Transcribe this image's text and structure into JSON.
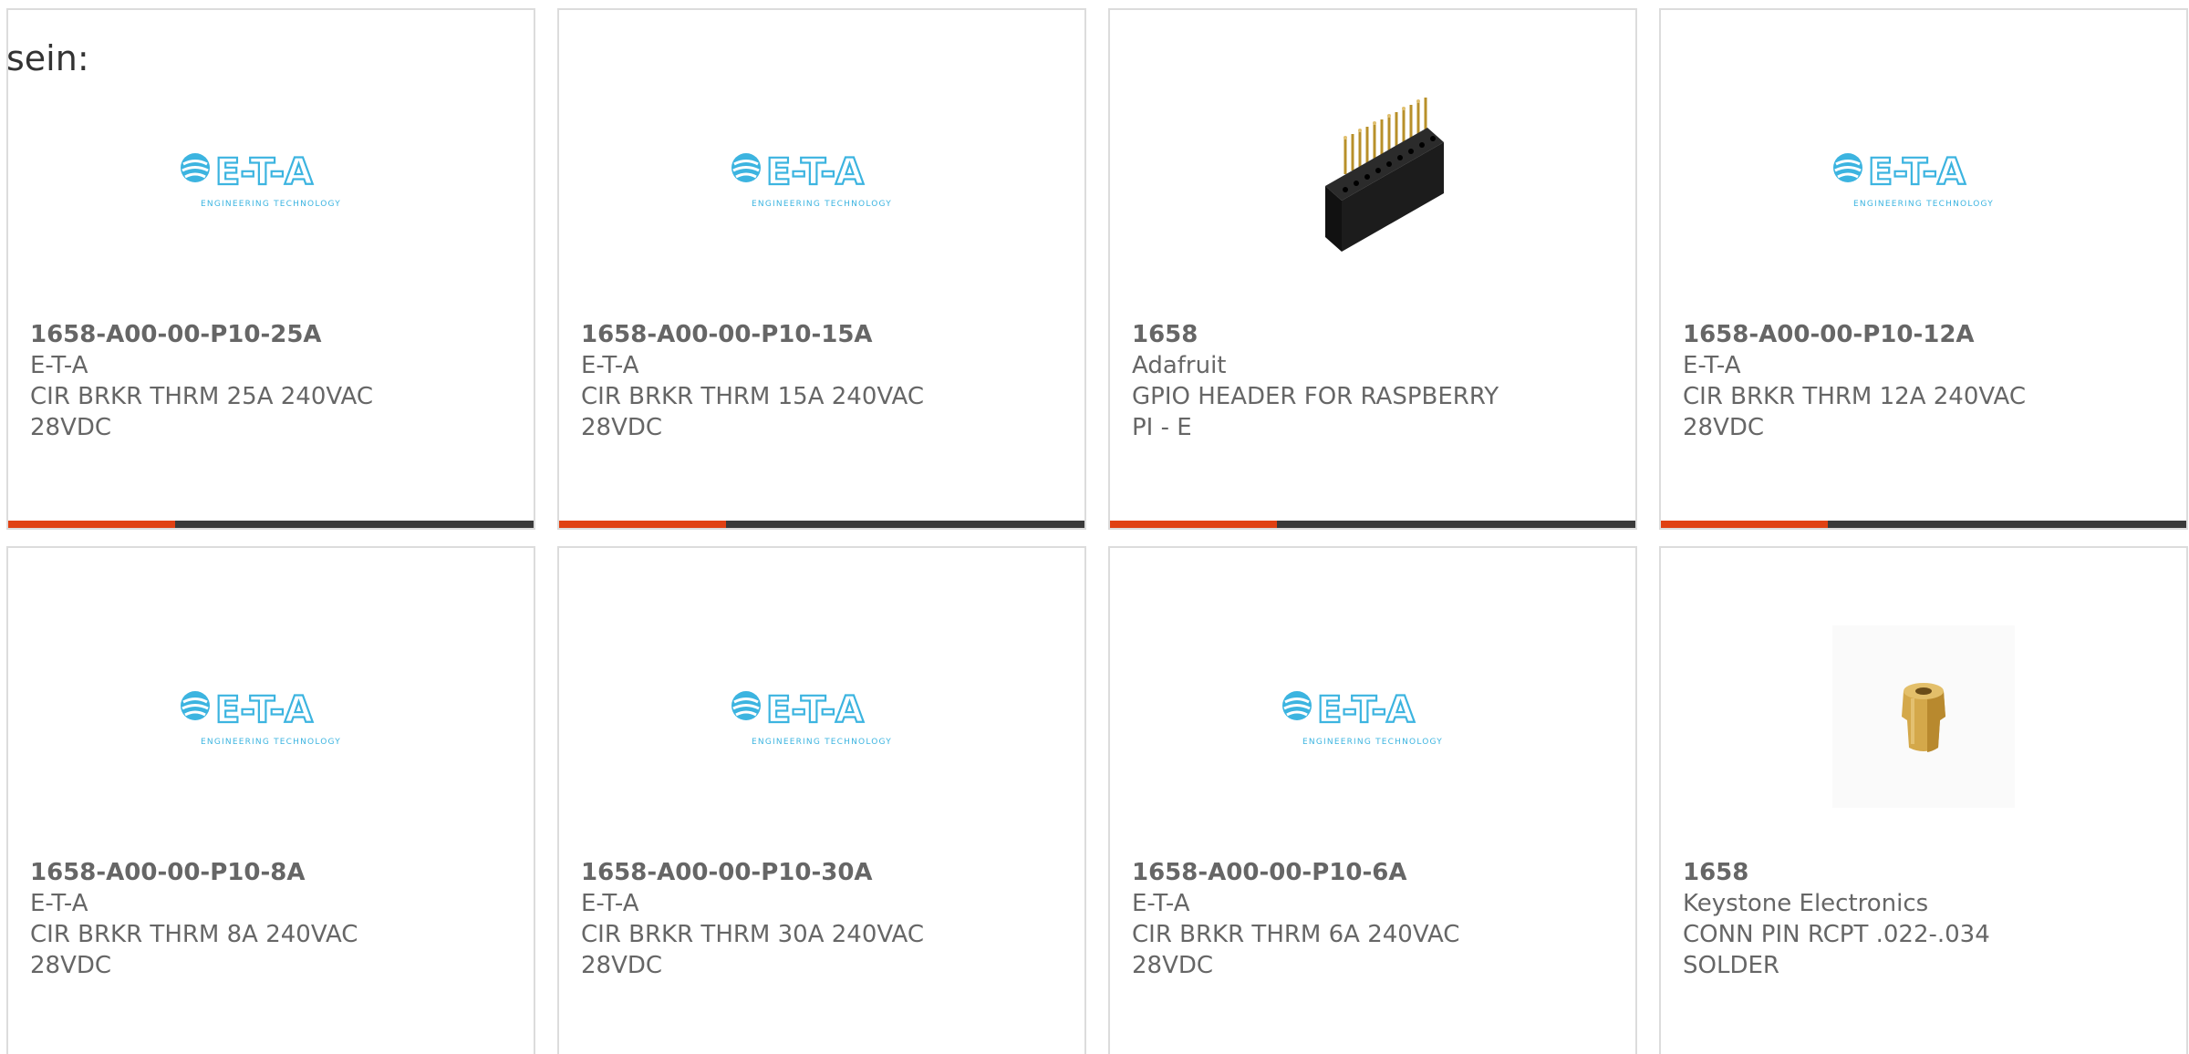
{
  "intro_text": "sein:",
  "colors": {
    "accent": "#e04113",
    "bar_dark": "#3a3a3a",
    "eta_blue": "#3cb4e0"
  },
  "cards": [
    {
      "part_number": "1658-A00-00-P10-25A",
      "manufacturer": "E-T-A",
      "description": "CIR BRKR THRM 25A 240VAC 28VDC",
      "image": "eta-logo",
      "logo": {
        "name": "E-T-A",
        "tagline": "ENGINEERING TECHNOLOGY"
      }
    },
    {
      "part_number": "1658-A00-00-P10-15A",
      "manufacturer": "E-T-A",
      "description": "CIR BRKR THRM 15A 240VAC 28VDC",
      "image": "eta-logo",
      "logo": {
        "name": "E-T-A",
        "tagline": "ENGINEERING TECHNOLOGY"
      }
    },
    {
      "part_number": "1658",
      "manufacturer": "Adafruit",
      "description": "GPIO HEADER FOR RASPBERRY PI - E",
      "image": "gpio-header-photo"
    },
    {
      "part_number": "1658-A00-00-P10-12A",
      "manufacturer": "E-T-A",
      "description": "CIR BRKR THRM 12A 240VAC 28VDC",
      "image": "eta-logo",
      "logo": {
        "name": "E-T-A",
        "tagline": "ENGINEERING TECHNOLOGY"
      }
    },
    {
      "part_number": "1658-A00-00-P10-8A",
      "manufacturer": "E-T-A",
      "description": "CIR BRKR THRM 8A 240VAC 28VDC",
      "image": "eta-logo",
      "logo": {
        "name": "E-T-A",
        "tagline": "ENGINEERING TECHNOLOGY"
      }
    },
    {
      "part_number": "1658-A00-00-P10-30A",
      "manufacturer": "E-T-A",
      "description": "CIR BRKR THRM 30A 240VAC 28VDC",
      "image": "eta-logo",
      "logo": {
        "name": "E-T-A",
        "tagline": "ENGINEERING TECHNOLOGY"
      }
    },
    {
      "part_number": "1658-A00-00-P10-6A",
      "manufacturer": "E-T-A",
      "description": "CIR BRKR THRM 6A 240VAC 28VDC",
      "image": "eta-logo",
      "logo": {
        "name": "E-T-A",
        "tagline": "ENGINEERING TECHNOLOGY"
      }
    },
    {
      "part_number": "1658",
      "manufacturer": "Keystone Electronics",
      "description": "CONN PIN RCPT .022-.034 SOLDER",
      "image": "pin-receptacle-photo"
    }
  ]
}
